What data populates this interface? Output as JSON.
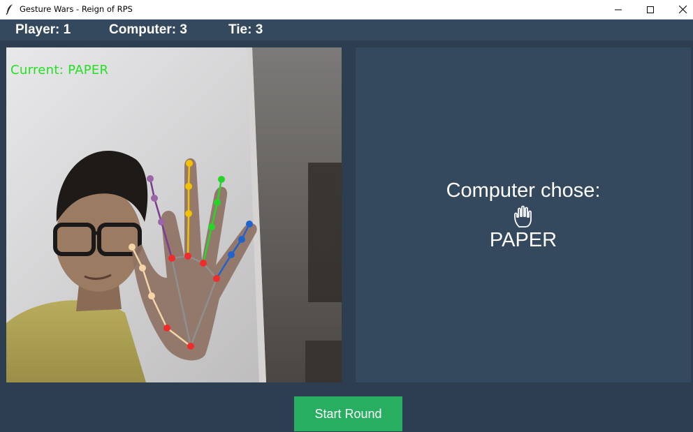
{
  "window": {
    "title": "Gesture Wars - Reign of RPS",
    "minimize_icon": "minimize-icon",
    "maximize_icon": "maximize-icon",
    "close_icon": "close-icon"
  },
  "scoreboard": {
    "player": "Player: 1",
    "computer": "Computer: 3",
    "tie": "Tie: 3"
  },
  "camera": {
    "current_gesture": "Current: PAPER"
  },
  "computer_panel": {
    "heading": "Computer chose:",
    "icon": "raised-hand-icon",
    "choice": "PAPER"
  },
  "controls": {
    "start_label": "Start Round"
  },
  "colors": {
    "background": "#2c3e50",
    "panel": "#34495e",
    "button": "#27ae60",
    "overlay_text": "#22e022"
  }
}
